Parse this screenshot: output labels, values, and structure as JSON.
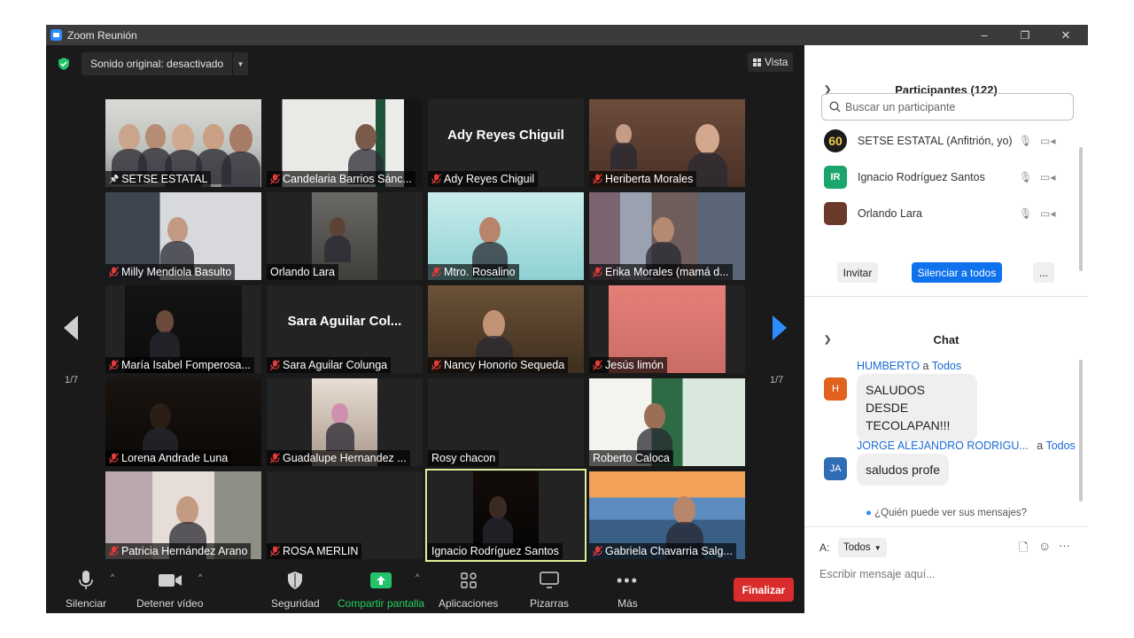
{
  "window": {
    "title": "Zoom Reunión",
    "minimize": "–",
    "restore": "❐",
    "close": "✕"
  },
  "top": {
    "audio_label": "Sonido original: desactivado",
    "view_label": "Vista"
  },
  "paging": {
    "left": "1/7",
    "right": "1/7"
  },
  "tiles": [
    {
      "name": "SETSE ESTATAL",
      "muted": false,
      "pinned": true,
      "video": true
    },
    {
      "name": "Candelaria Barrios Sánc...",
      "muted": true,
      "video": true
    },
    {
      "name": "Ady Reyes Chiguil",
      "muted": true,
      "video": false,
      "bigname": "Ady Reyes Chiguil"
    },
    {
      "name": "Heriberta Morales",
      "muted": true,
      "video": true
    },
    {
      "name": "Milly Mendiola Basulto",
      "muted": true,
      "video": true
    },
    {
      "name": "Orlando Lara",
      "muted": false,
      "video": true
    },
    {
      "name": "Mtro. Rosalino",
      "muted": true,
      "video": true
    },
    {
      "name": "Erika Morales (mamá d...",
      "muted": true,
      "video": true
    },
    {
      "name": "María Isabel Fomperosa...",
      "muted": true,
      "video": true
    },
    {
      "name": "Sara Aguilar Colunga",
      "muted": true,
      "video": false,
      "bigname": "Sara  Aguilar  Col..."
    },
    {
      "name": "Nancy Honorio Sequeda",
      "muted": true,
      "video": true
    },
    {
      "name": "Jesús limón",
      "muted": true,
      "video": true
    },
    {
      "name": "Lorena Andrade Luna",
      "muted": true,
      "video": true
    },
    {
      "name": "Guadalupe Hernandez ...",
      "muted": true,
      "video": true
    },
    {
      "name": "Rosy chacon",
      "muted": false,
      "video": false
    },
    {
      "name": "Roberto Caloca",
      "muted": false,
      "video": true
    },
    {
      "name": "Patricia Hernández Arano",
      "muted": true,
      "video": true
    },
    {
      "name": "ROSA MERLIN",
      "muted": true,
      "video": false
    },
    {
      "name": "Ignacio Rodríguez Santos",
      "muted": false,
      "video": true,
      "active": true
    },
    {
      "name": "Gabriela Chavarria Salg...",
      "muted": true,
      "video": true
    }
  ],
  "toolbar": {
    "mute": "Silenciar",
    "video": "Detener vídeo",
    "security": "Seguridad",
    "share": "Compartir pantalla",
    "apps": "Aplicaciones",
    "whiteboards": "Pizarras",
    "more": "Más",
    "end": "Finalizar"
  },
  "participants": {
    "title": "Participantes (122)",
    "search_placeholder": "Buscar un participante",
    "list": [
      {
        "name": "SETSE ESTATAL (Anfitrión, yo)",
        "avatar": "60",
        "color": "#1b1b1b"
      },
      {
        "name": "Ignacio Rodríguez Santos",
        "avatar": "IR",
        "color": "#1aa56b"
      },
      {
        "name": "Orlando Lara",
        "avatar": "",
        "color": "#6b3a2a"
      }
    ],
    "invite": "Invitar",
    "mute_all": "Silenciar a todos",
    "more": "..."
  },
  "chat": {
    "title": "Chat",
    "messages": [
      {
        "from": "HUMBERTO",
        "to": "Todos",
        "avatar": "H",
        "color": "#e0621e",
        "text": "SALUDOS DESDE TECOLAPAN!!!"
      },
      {
        "from": "JORGE ALEJANDRO RODRIGU...",
        "to": "Todos",
        "avatar": "JA",
        "color": "#2f6db5",
        "text": "saludos profe"
      }
    ],
    "who_can_see": "¿Quién puede ver sus mensajes?",
    "to_label": "A:",
    "to_value": "Todos",
    "placeholder": "Escribir mensaje aquí..."
  },
  "accent": "#2d8cff"
}
